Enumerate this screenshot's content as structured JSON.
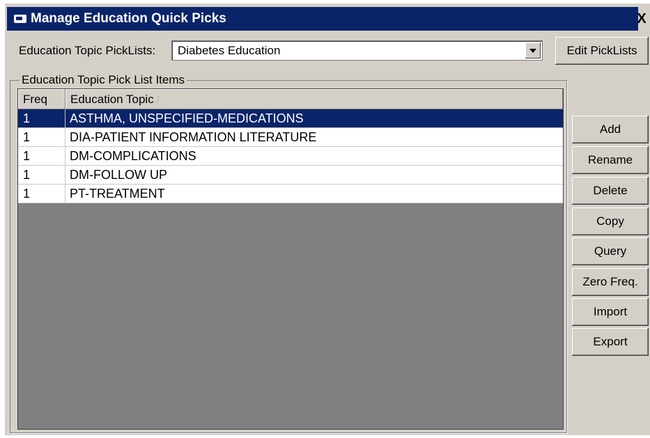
{
  "window": {
    "title": "Manage Education Quick Picks",
    "close_glyph": "X"
  },
  "picklist": {
    "label": "Education Topic PickLists:",
    "value": "Diabetes Education",
    "edit_button": "Edit PickLists"
  },
  "group": {
    "label": "Education Topic Pick List Items"
  },
  "table": {
    "headers": {
      "freq": "Freq",
      "topic": "Education Topic"
    },
    "sort_glyph": "/",
    "rows": [
      {
        "freq": "1",
        "topic": "ASTHMA, UNSPECIFIED-MEDICATIONS",
        "selected": true
      },
      {
        "freq": "1",
        "topic": "DIA-PATIENT INFORMATION LITERATURE",
        "selected": false
      },
      {
        "freq": "1",
        "topic": "DM-COMPLICATIONS",
        "selected": false
      },
      {
        "freq": "1",
        "topic": "DM-FOLLOW UP",
        "selected": false
      },
      {
        "freq": "1",
        "topic": "PT-TREATMENT",
        "selected": false
      }
    ]
  },
  "buttons": {
    "add": "Add",
    "rename": "Rename",
    "delete": "Delete",
    "copy": "Copy",
    "query": "Query",
    "zero_freq": "Zero Freq.",
    "import": "Import",
    "export": "Export"
  },
  "colors": {
    "title_bar": "#0a246a",
    "selection": "#0a246a",
    "face": "#d4d0c8",
    "grid_background": "#808080"
  }
}
